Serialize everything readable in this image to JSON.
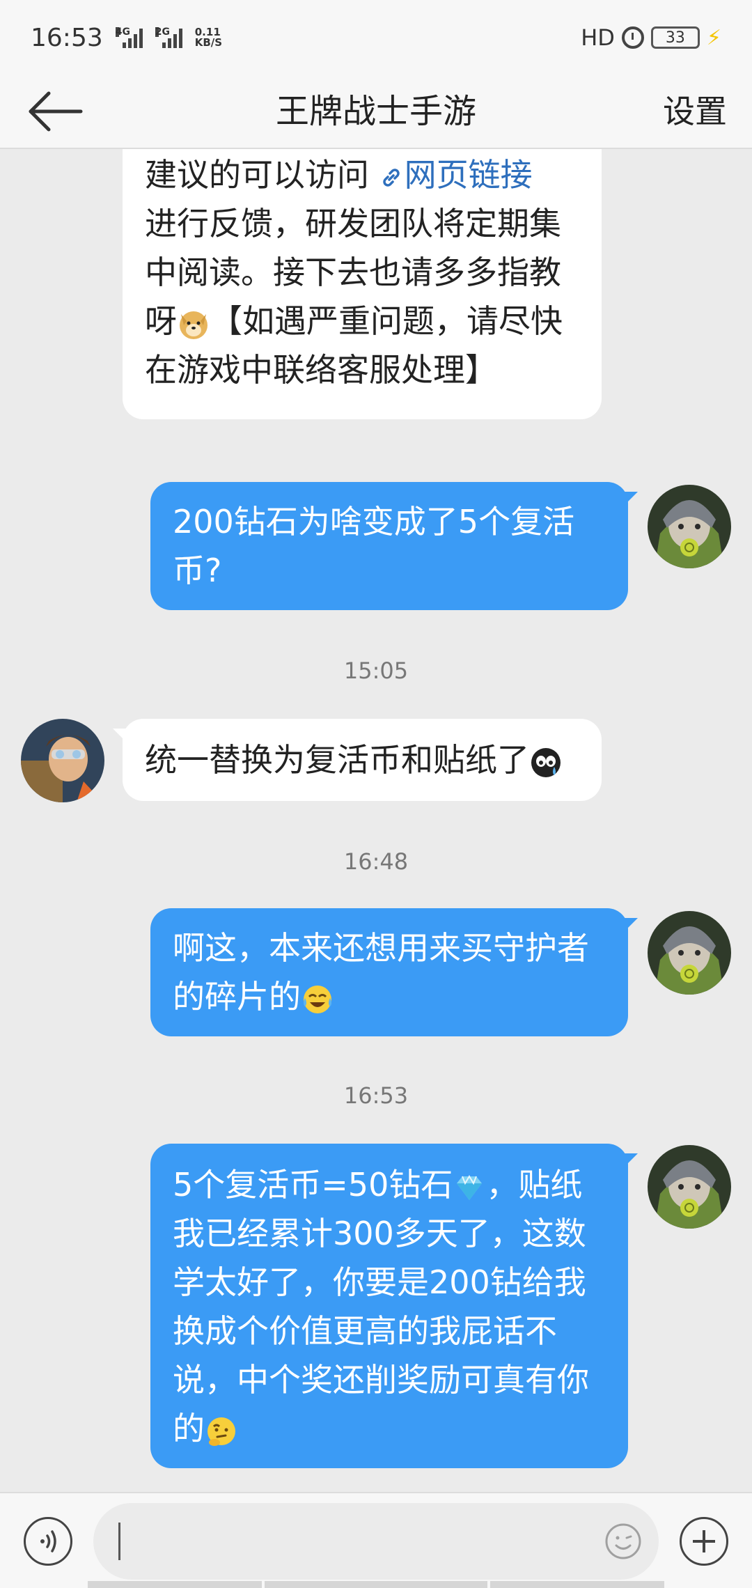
{
  "status_bar": {
    "time": "16:53",
    "net1": "4G",
    "net2": "2G",
    "speed_value": "0.11",
    "speed_unit": "KB/S",
    "hd": "HD",
    "battery": "33"
  },
  "header": {
    "title": "王牌战士手游",
    "settings_label": "设置"
  },
  "messages": [
    {
      "side": "in",
      "line1_prefix": "建议的可以访问 ",
      "link_label": "网页链接",
      "line2": "进行反馈，研发团队将定期集",
      "line3": "中阅读。接下去也请多多指教",
      "line4_prefix": "呀",
      "line4_suffix": "【如遇严重问题，请尽快",
      "line5": "在游戏中联络客服处理】"
    },
    {
      "side": "out",
      "line1": "200钻石为啥变成了5个复活",
      "line2": "币?"
    },
    {
      "time_sep": "15:05"
    },
    {
      "side": "in",
      "text": "统一替换为复活币和贴纸了"
    },
    {
      "time_sep": "16:48"
    },
    {
      "side": "out",
      "line1": "啊这，本来还想用来买守护者",
      "line2": "的碎片的"
    },
    {
      "time_sep": "16:53"
    },
    {
      "side": "out",
      "line1": "5个复活币=50钻石",
      "line1_suffix": "，贴纸",
      "line2": "我已经累计300多天了，这数",
      "line3": "学太好了，你要是200钻给我",
      "line4": "换成个价值更高的我屁话不",
      "line5": "说，中个奖还削奖励可真有你",
      "line6": "的"
    }
  ],
  "icons": {
    "back": "back-arrow-icon",
    "link": "link-icon",
    "voice": "voice-icon",
    "emoji": "smile-icon",
    "plus": "plus-icon"
  },
  "colors": {
    "outgoing_bubble": "#3b9bf5",
    "incoming_bubble": "#ffffff",
    "link": "#2e6fbd",
    "background": "#ebebeb"
  }
}
